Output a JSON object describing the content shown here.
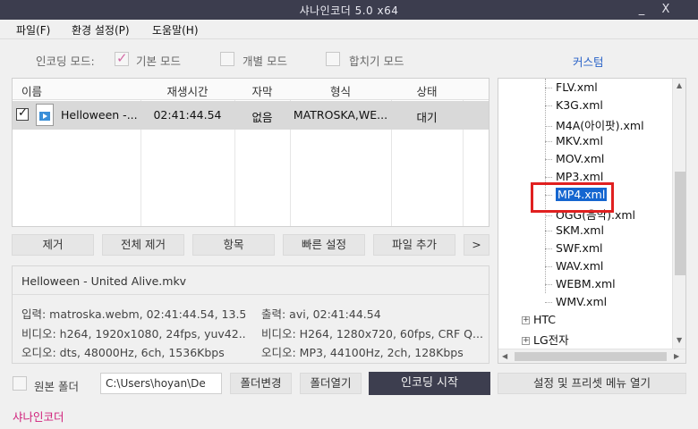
{
  "window": {
    "title": "샤나인코더  5.0  x64",
    "min": "_",
    "close": "X"
  },
  "menu": [
    "파일(F)",
    "환경 설정(P)",
    "도움말(H)"
  ],
  "modes": {
    "label": "인코딩 모드:",
    "basic": {
      "label": "기본 모드",
      "checked": true
    },
    "individual": {
      "label": "개별 모드",
      "checked": false
    },
    "merge": {
      "label": "합치기 모드",
      "checked": false
    }
  },
  "custom_title": "커스텀",
  "table": {
    "headers": [
      "이름",
      "재생시간",
      "자막",
      "형식",
      "상태"
    ],
    "rows": [
      {
        "name": "Helloween -...",
        "duration": "02:41:44.54",
        "subtitle": "없음",
        "format": "MATROSKA,WE...",
        "status": "대기"
      }
    ]
  },
  "actions": [
    "제거",
    "전체 제거",
    "항목",
    "빠른 설정",
    "파일 추가",
    ">"
  ],
  "info": {
    "filename": "Helloween - United Alive.mkv",
    "input": "입력: matroska.webm, 02:41:44.54, 13.5...",
    "output": "출력: avi, 02:41:44.54",
    "video_in": "비디오: h264, 1920x1080, 24fps,  yuv42...",
    "video_out": "비디오: H264, 1280x720, 60fps, CRF Q...",
    "audio_in": "오디오: dts, 48000Hz, 6ch, 1536Kbps",
    "audio_out": "오디오: MP3, 44100Hz, 2ch, 128Kbps"
  },
  "tree": {
    "files": [
      "FLV.xml",
      "K3G.xml",
      "M4A(아이팟).xml",
      "MKV.xml",
      "MOV.xml",
      "MP3.xml",
      "MP4.xml",
      "OGG(음악).xml",
      "SKM.xml",
      "SWF.xml",
      "WAV.xml",
      "WEBM.xml",
      "WMV.xml"
    ],
    "selected": "MP4.xml",
    "groups": [
      "HTC",
      "LG전자"
    ]
  },
  "bottom": {
    "source_folder": "원본 폴더",
    "path": "C:\\Users\\hoyan\\De",
    "change_folder": "폴더변경",
    "open_folder": "폴더열기",
    "start": "인코딩 시작",
    "settings": "설정 및 프리셋 메뉴 열기"
  },
  "footer": "샤나인코더"
}
